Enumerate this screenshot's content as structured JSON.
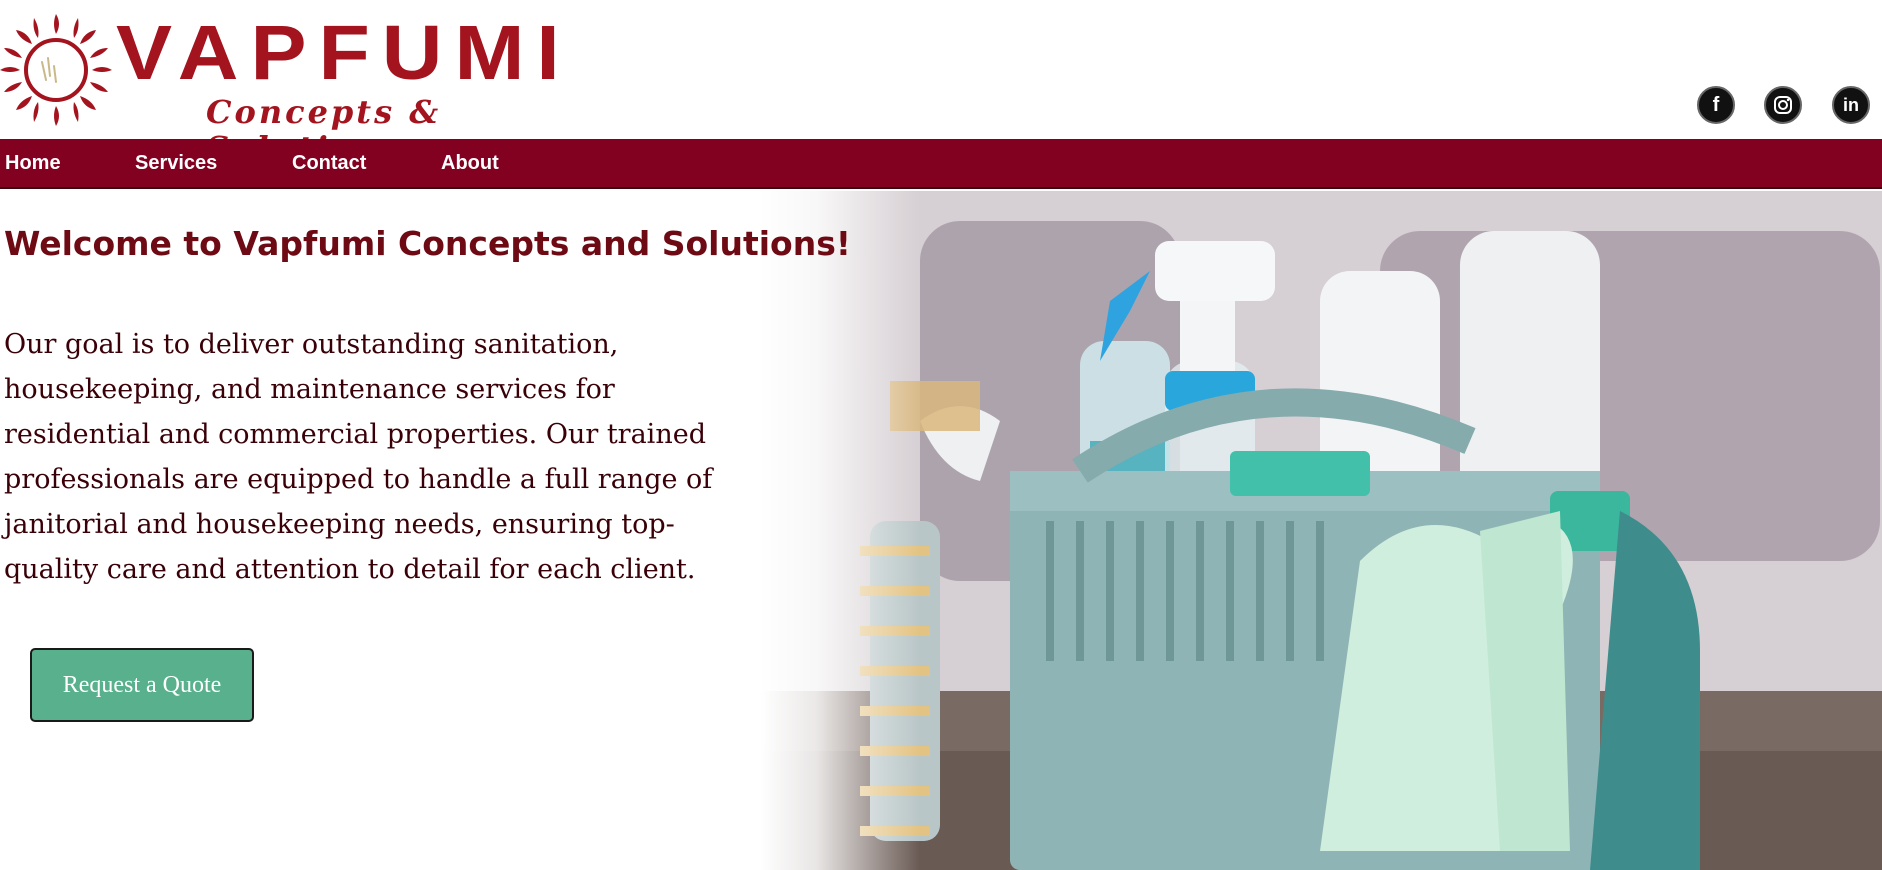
{
  "brand": {
    "name": "VAPFUMI",
    "tagline": "Concepts & Solutions"
  },
  "social": [
    {
      "icon": "facebook-icon",
      "glyph": "f"
    },
    {
      "icon": "instagram-icon",
      "glyph": ""
    },
    {
      "icon": "linkedin-icon",
      "glyph": "in"
    }
  ],
  "nav": {
    "items": [
      "Home",
      "Services",
      "Contact",
      "About"
    ]
  },
  "hero": {
    "title": "Welcome to Vapfumi Concepts and Solutions!",
    "body": "Our goal is to deliver outstanding sanitation, housekeeping, and maintenance services for residential and commercial properties. Our trained professionals are equipped to handle a full range of janitorial and housekeeping needs, ensuring top-quality care and attention to detail for each client.",
    "cta_label": "Request a Quote",
    "image_subject": "cleaning-supplies-basket"
  },
  "colors": {
    "brand_red": "#a3141f",
    "nav_bg": "#820020",
    "title_text": "#6e0a14",
    "cta_bg": "#58b08d"
  }
}
